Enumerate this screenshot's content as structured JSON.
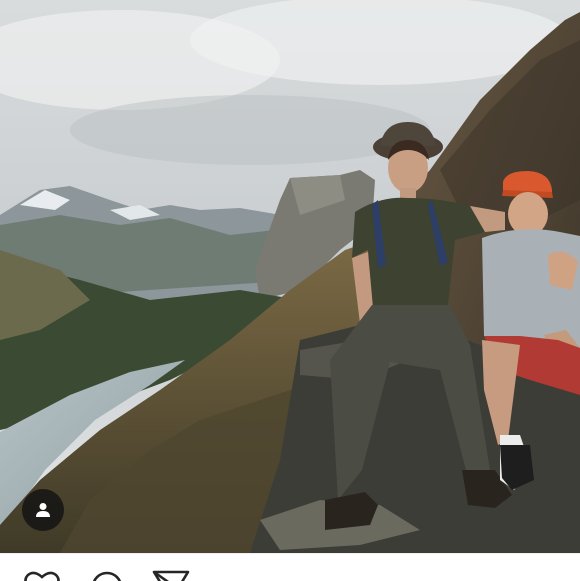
{
  "post": {
    "image_alt": "",
    "tag_icon": "person-tag-icon"
  },
  "actions": {
    "like_icon": "heart-icon",
    "comment_icon": "comment-bubble-icon",
    "share_icon": "direct-share-icon"
  },
  "colors": {
    "background": "#ffffff",
    "icon": "#262626",
    "tag_bubble": "#141414"
  }
}
